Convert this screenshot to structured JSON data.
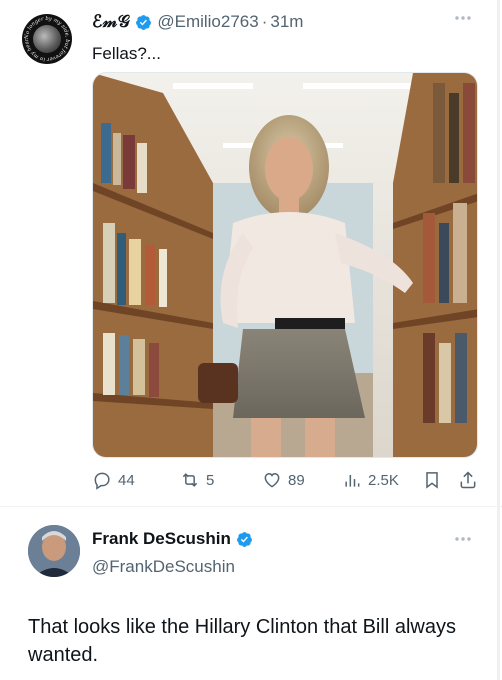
{
  "post": {
    "author_display": "ℰ𝓂𝒢",
    "handle": "@Emilio2763",
    "time": "31m",
    "text": "Fellas?...",
    "avatar_ring_text": "No longer by my side, but forever in my heart",
    "stats": {
      "replies": "44",
      "reposts": "5",
      "likes": "89",
      "views": "2.5K"
    }
  },
  "reply": {
    "name": "Frank DeScushin",
    "handle": "@FrankDeScushin",
    "text": "That looks like the Hillary Clinton that Bill always wanted."
  },
  "colors": {
    "verified": "#1d9bf0",
    "muted": "#536471",
    "text": "#0f1419"
  }
}
